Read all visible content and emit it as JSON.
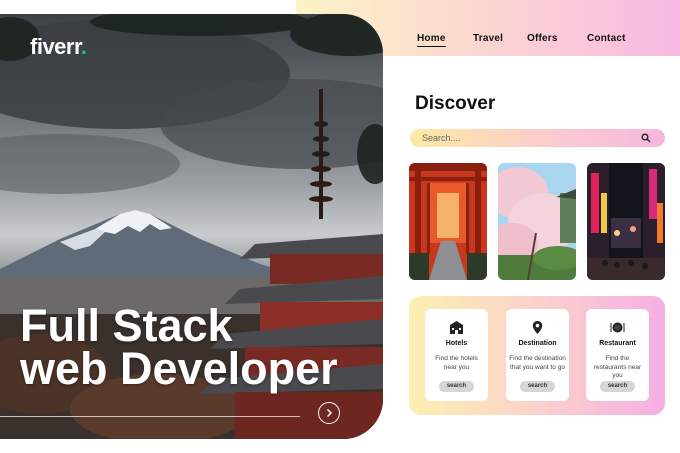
{
  "brand": {
    "logo_text": "fiverr",
    "logo_dot": ".",
    "logo_dot_color": "#1dbf73"
  },
  "nav": {
    "items": [
      {
        "label": "Home",
        "active": true
      },
      {
        "label": "Travel",
        "active": false
      },
      {
        "label": "Offers",
        "active": false
      },
      {
        "label": "Contact",
        "active": false
      }
    ]
  },
  "hero": {
    "title_line1": "Full Stack",
    "title_line2": "web Developer",
    "next_icon": "chevron-right-icon"
  },
  "discover": {
    "heading": "Discover",
    "search": {
      "placeholder": "Search....",
      "icon": "search-icon"
    },
    "photos": [
      {
        "name": "torii-gate-tunnel-photo"
      },
      {
        "name": "cherry-blossom-photo"
      },
      {
        "name": "city-night-street-photo"
      }
    ]
  },
  "categories": [
    {
      "icon": "hotel-icon",
      "title": "Hotels",
      "description": "Find the hotels near you",
      "button": "search"
    },
    {
      "icon": "location-pin-icon",
      "title": "Destination",
      "description": "Find the destination that you want to go",
      "button": "search"
    },
    {
      "icon": "dish-icon",
      "title": "Restaurant",
      "description": "Find the restaurants near you",
      "button": "search"
    }
  ],
  "colors": {
    "accent_yellow": "#fbeaa3",
    "accent_pink": "#f7b6e0",
    "text_dark": "#111111"
  }
}
